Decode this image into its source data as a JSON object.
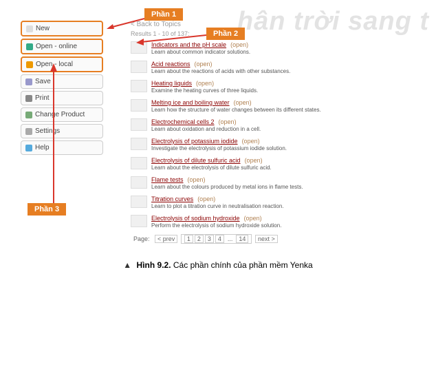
{
  "watermark": "hân trời sang t",
  "labels": {
    "phan1": "Phần 1",
    "phan2": "Phần 2",
    "phan3": "Phần 3"
  },
  "sidebar": {
    "items": [
      {
        "label": "New",
        "highlighted": true,
        "icon": "new-icon"
      },
      {
        "label": "Open - online",
        "highlighted": true,
        "icon": "globe-icon"
      },
      {
        "label": "Open - local",
        "highlighted": true,
        "icon": "folder-icon"
      },
      {
        "label": "Save",
        "highlighted": false,
        "icon": "save-icon"
      },
      {
        "label": "Print",
        "highlighted": false,
        "icon": "print-icon"
      },
      {
        "label": "Change Product",
        "highlighted": false,
        "icon": "product-icon"
      },
      {
        "label": "Settings",
        "highlighted": false,
        "icon": "settings-icon"
      },
      {
        "label": "Help",
        "highlighted": false,
        "icon": "help-icon"
      }
    ]
  },
  "content": {
    "back": "< Back to Topics",
    "results": "Results 1 - 10 of 137:",
    "open_label": "(open)",
    "topics": [
      {
        "title": "Indicators and the pH scale",
        "desc": "Learn about common indicator solutions."
      },
      {
        "title": "Acid reactions",
        "desc": "Learn about the reactions of acids with other substances."
      },
      {
        "title": "Heating liquids",
        "desc": "Examine the heating curves of three liquids."
      },
      {
        "title": "Melting ice and boiling water",
        "desc": "Learn how the structure of water changes between its different states."
      },
      {
        "title": "Electrochemical cells 2",
        "desc": "Learn about oxidation and reduction in a cell."
      },
      {
        "title": "Electrolysis of potassium iodide",
        "desc": "Investigate the electrolysis of potassium iodide solution."
      },
      {
        "title": "Electrolysis of dilute sulfuric acid",
        "desc": "Learn about the electrolysis of dilute sulfuric acid."
      },
      {
        "title": "Flame tests",
        "desc": "Learn about the colours produced by metal ions in flame tests."
      },
      {
        "title": "Titration curves",
        "desc": "Learn to plot a titration curve in neutralisation reaction."
      },
      {
        "title": "Electrolysis of sodium hydroxide",
        "desc": "Perform the electrolysis of sodium hydroxide solution."
      }
    ],
    "pager": {
      "page_label": "Page:",
      "prev": "< prev",
      "pages": [
        "1",
        "2",
        "3",
        "4",
        "...",
        "14"
      ],
      "next": "next >"
    }
  },
  "caption": {
    "figure": "Hình 9.2.",
    "text": "Các phần chính của phần mềm Yenka"
  }
}
